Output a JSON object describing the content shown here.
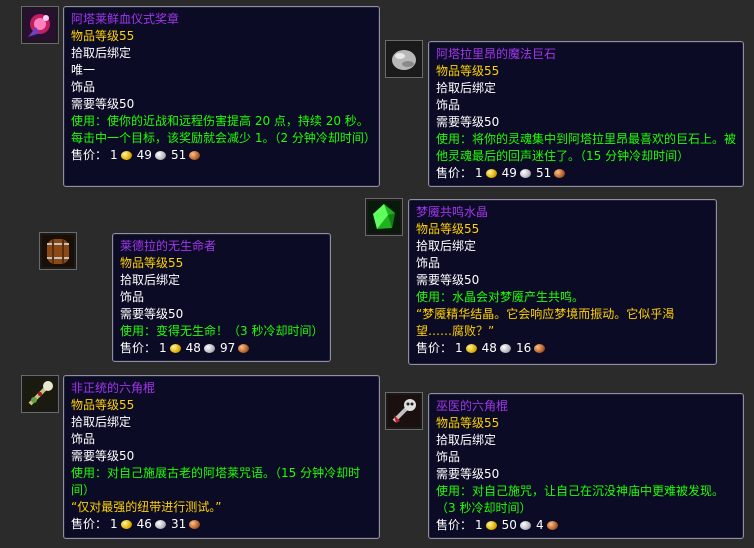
{
  "items": [
    {
      "name": "阿塔莱鲜血仪式奖章",
      "icon": "blood-ritual-medallion-icon",
      "item_level": "物品等级55",
      "binding": "拾取后绑定",
      "unique": "唯一",
      "type": "饰品",
      "req_level": "需要等级50",
      "use": "使用：使你的近战和远程伤害提高 20 点，持续 20 秒。每击中一个目标，该奖励就会减少 1。（2 分钟冷却时间）",
      "price_label": "售价：",
      "gold": "1",
      "silver": "49",
      "copper": "51"
    },
    {
      "name": "阿塔拉里昂的魔法巨石",
      "icon": "enchanted-boulder-icon",
      "item_level": "物品等级55",
      "binding": "拾取后绑定",
      "type": "饰品",
      "req_level": "需要等级50",
      "use": "使用：将你的灵魂集中到阿塔拉里昂最喜欢的巨石上。被他灵魂最后的回声迷住了。（15 分钟冷却时间）",
      "price_label": "售价：",
      "gold": "1",
      "silver": "49",
      "copper": "51"
    },
    {
      "name": "梦魇共鸣水晶",
      "icon": "green-crystal-icon",
      "item_level": "物品等级55",
      "binding": "拾取后绑定",
      "type": "饰品",
      "req_level": "需要等级50",
      "use": "使用：水晶会对梦魇产生共鸣。",
      "flavor": "“梦魇精华结晶。它会响应梦境而振动。它似乎渴望……腐败？”",
      "price_label": "售价：",
      "gold": "1",
      "silver": "48",
      "copper": "16"
    },
    {
      "name": "莱德拉的无生命者",
      "icon": "barrel-icon",
      "item_level": "物品等级55",
      "binding": "拾取后绑定",
      "type": "饰品",
      "req_level": "需要等级50",
      "use": "使用：变得无生命！（3 秒冷却时间）",
      "price_label": "售价：",
      "gold": "1",
      "silver": "48",
      "copper": "97"
    },
    {
      "name": "非正统的六角棍",
      "icon": "hex-stick-icon",
      "item_level": "物品等级55",
      "binding": "拾取后绑定",
      "type": "饰品",
      "req_level": "需要等级50",
      "use": "使用：对自己施展古老的阿塔莱咒语。（15 分钟冷却时间）",
      "flavor": "“仅对最强的纽带进行测试。”",
      "price_label": "售价：",
      "gold": "1",
      "silver": "46",
      "copper": "31"
    },
    {
      "name": "巫医的六角棍",
      "icon": "witch-doctor-stick-icon",
      "item_level": "物品等级55",
      "binding": "拾取后绑定",
      "type": "饰品",
      "req_level": "需要等级50",
      "use": "使用：对自己施咒，让自己在沉没神庙中更难被发现。（3 秒冷却时间）",
      "price_label": "售价：",
      "gold": "1",
      "silver": "50",
      "copper": "4"
    }
  ],
  "colors": {
    "name": "#a335ee",
    "item_level": "#ffd100",
    "use": "#1eff00",
    "flavor": "#ffd100",
    "tooltip_bg": "#0b0b25"
  }
}
